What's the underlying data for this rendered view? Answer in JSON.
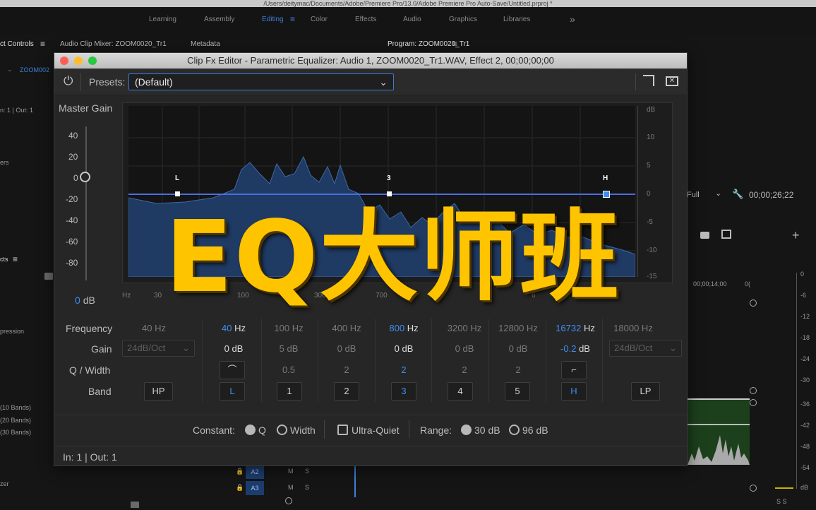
{
  "path": "/Users/deitymac/Documents/Adobe/Premiere Pro/13.0/Adobe Premiere Pro Auto-Save/Untitled.prproj *",
  "workspaces": [
    "Learning",
    "Assembly",
    "Editing",
    "Color",
    "Effects",
    "Audio",
    "Graphics",
    "Libraries"
  ],
  "workspaces_more": "»",
  "panels": {
    "effect_controls": "ct Controls",
    "audio_mixer": "Audio Clip Mixer: ZOOM0020_Tr1",
    "metadata": "Metadata",
    "program": "Program: ZOOM0020_Tr1"
  },
  "left_side": {
    "clip": "ZOOM002",
    "inout": "n: 1 | Out: 1",
    "ers": "ers",
    "cts": "cts",
    "pression": "pression",
    "b10": "(10 Bands)",
    "b20": "(20 Bands)",
    "b30": "(30 Bands)",
    "zer": "zer"
  },
  "right_side": {
    "full": "Full",
    "timecode": "00;00;26;22",
    "tc2": "00;00;14;00",
    "tc3": "0(",
    "meter": [
      "0",
      "-6",
      "-12",
      "-18",
      "-24",
      "-30",
      "-36",
      "-42",
      "-48",
      "-54",
      "dB"
    ],
    "ss": "S S"
  },
  "timeline": {
    "a2": "A2",
    "a3": "A3",
    "m": "M",
    "s": "S"
  },
  "window": {
    "title": "Clip Fx Editor - Parametric Equalizer: Audio 1, ZOOM0020_Tr1.WAV, Effect 2, 00;00;00;00",
    "presets_label": "Presets:",
    "preset_value": "(Default)",
    "master_gain": "Master Gain",
    "gain_ticks": [
      "40",
      "20",
      "0",
      "-20",
      "-40",
      "-60",
      "-80"
    ],
    "master_value": "0",
    "master_unit": "dB",
    "db_unit": "dB",
    "db_ticks": [
      "10",
      "5",
      "0",
      "-5",
      "-10",
      "-15"
    ],
    "freq_ticks": [
      "Hz",
      "30",
      "100",
      "300",
      "700",
      "6"
    ],
    "nodes": [
      {
        "label": "L"
      },
      {
        "label": "3"
      },
      {
        "label": "H"
      }
    ],
    "row_labels": {
      "frequency": "Frequency",
      "gain": "Gain",
      "q": "Q / Width",
      "band": "Band"
    },
    "columns": [
      {
        "freq": "40 Hz",
        "gain": "24dB/Oct",
        "q": "",
        "band": "HP",
        "state": "off"
      },
      {
        "freq_num": "40",
        "freq_unit": "Hz",
        "gain_num": "0",
        "gain_unit": "dB",
        "q": "shelf",
        "band": "L",
        "state": "on"
      },
      {
        "freq": "100 Hz",
        "gain": "5 dB",
        "q": "0.5",
        "band": "1",
        "state": "off"
      },
      {
        "freq": "400 Hz",
        "gain": "0 dB",
        "q": "2",
        "band": "2",
        "state": "off"
      },
      {
        "freq_num": "800",
        "freq_unit": "Hz",
        "gain_num": "0",
        "gain_unit": "dB",
        "q": "2",
        "band": "3",
        "state": "on"
      },
      {
        "freq": "3200 Hz",
        "gain": "0 dB",
        "q": "2",
        "band": "4",
        "state": "off"
      },
      {
        "freq": "12800 Hz",
        "gain": "0 dB",
        "q": "2",
        "band": "5",
        "state": "off"
      },
      {
        "freq_num": "16732",
        "freq_unit": "Hz",
        "gain_num": "-0.2",
        "gain_unit": "dB",
        "q": "shelf",
        "band": "H",
        "state": "on"
      },
      {
        "freq": "18000 Hz",
        "gain": "24dB/Oct",
        "q": "",
        "band": "LP",
        "state": "off"
      }
    ],
    "constant_label": "Constant:",
    "constant_q": "Q",
    "constant_width": "Width",
    "ultra_quiet": "Ultra-Quiet",
    "range_label": "Range:",
    "range_30": "30 dB",
    "range_96": "96 dB",
    "inout": "In: 1 | Out: 1"
  },
  "overlay_text": "EQ大师班",
  "colors": {
    "accent": "#3f8ef0",
    "overlay": "#ffc400",
    "curve": "#4a6fe0"
  }
}
